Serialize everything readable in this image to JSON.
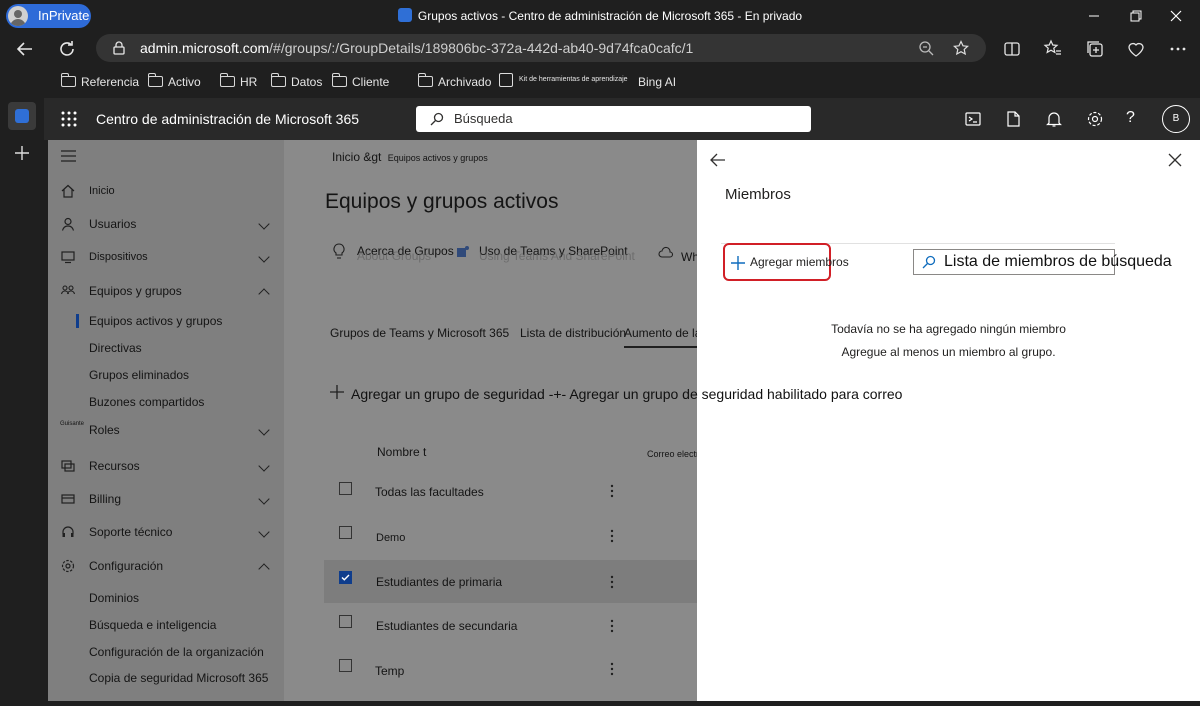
{
  "browser": {
    "inprivate_label": "InPrivate",
    "window_title": "Grupos activos - Centro de administración de Microsoft 365 - En privado",
    "url_host": "admin.microsoft.com",
    "url_path": "/#/groups/:/GroupDetails/189806bc-372a-442d-ab40-9d74fca0cafc/1",
    "favorites": [
      "Referencia",
      "Activo",
      "HR",
      "Datos",
      "Cliente",
      "Archivado",
      "Kit de herramientas de aprendizaje",
      "Bing AI"
    ]
  },
  "header": {
    "app_title": "Centro de administración de Microsoft 365",
    "search_placeholder": "Búsqueda",
    "avatar_initial": "B"
  },
  "nav": {
    "items": [
      {
        "label": "Inicio",
        "icon": "home-icon"
      },
      {
        "label": "Usuarios",
        "icon": "user-icon"
      },
      {
        "label": "Dispositivos",
        "icon": "device-icon"
      },
      {
        "label": "Equipos y grupos",
        "icon": "groups-icon"
      },
      {
        "label": "Equipos activos y grupos"
      },
      {
        "label": "Directivas"
      },
      {
        "label": "Grupos eliminados"
      },
      {
        "label": "Buzones compartidos"
      },
      {
        "label": "Roles",
        "prefix": "Guisante"
      },
      {
        "label": "Recursos",
        "icon": "resources-icon"
      },
      {
        "label": "Billing",
        "icon": "billing-icon"
      },
      {
        "label": "Soporte técnico",
        "icon": "headset-icon"
      },
      {
        "label": "Configuración",
        "icon": "gear-icon"
      },
      {
        "label": "Dominios"
      },
      {
        "label": "Búsqueda e inteligencia"
      },
      {
        "label": "Configuración de la organización"
      },
      {
        "label": "Copia de seguridad Microsoft 365"
      }
    ]
  },
  "main": {
    "breadcrumb_home": "Inicio &gt",
    "breadcrumb_current": "Equipos activos y grupos",
    "title": "Equipos y grupos activos",
    "about_label": "Acerca de Grupos",
    "about_ghost": "About Groups",
    "usage_label": "Uso de Teams y SharePoint",
    "usage_ghost": "Using Teams And SharePoint",
    "wh_label": "Wh",
    "tabs": [
      "Grupos de Teams y Microsoft 365",
      "Lista de distribución",
      "Aumento de la"
    ],
    "add_security": "Agregar un grupo de seguridad -+- Agregar un grupo de seguridad habilitado para correo",
    "col_name": "Nombre t",
    "col_email": "Correo electrónico",
    "rows": [
      {
        "name": "Todas las facultades",
        "checked": false
      },
      {
        "name": "Demo",
        "checked": false
      },
      {
        "name": "Estudiantes de primaria",
        "checked": true
      },
      {
        "name": "Estudiantes de secundaria",
        "checked": false
      },
      {
        "name": "Temp",
        "checked": false
      }
    ]
  },
  "panel": {
    "title": "Miembros",
    "add_members": "Agregar miembros",
    "search_placeholder": "Lista de miembros de búsqueda",
    "empty_title": "Todavía no se ha agregado ningún miembro",
    "empty_sub": "Agregue al menos un miembro al grupo."
  },
  "colors": {
    "accent": "#0f6cbd",
    "highlight_border": "#d11f26",
    "inprivate": "#2e6bd8"
  }
}
